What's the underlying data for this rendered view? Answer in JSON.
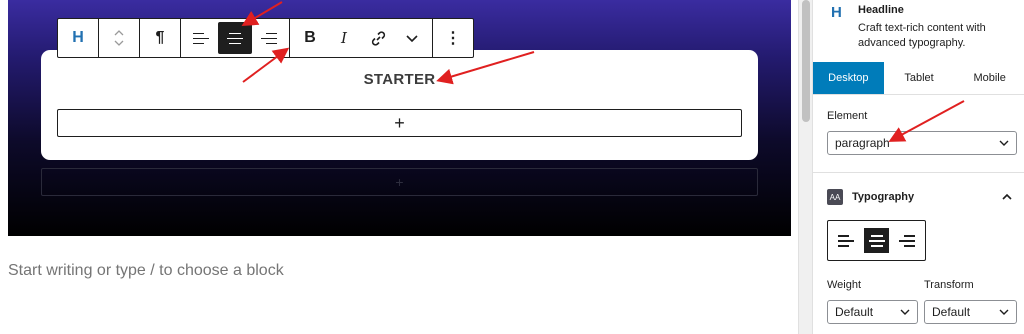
{
  "editor": {
    "card_title": "STARTER",
    "appender_symbol": "+",
    "ghost_appender_symbol": "+",
    "placeholder": "Start writing or type / to choose a block"
  },
  "toolbar": {
    "block_icon": "H",
    "block_icon_name": "headline-block-icon",
    "mover_icon": "up-down-chevron-icon",
    "element_icon": "¶",
    "align_left": "align-left-icon",
    "align_center": "align-center-icon",
    "align_right": "align-right-icon",
    "active_align": "center",
    "bold": "B",
    "italic": "I",
    "link_icon": "link-icon",
    "more_format_icon": "chevron-down-icon",
    "options_icon": "⋮"
  },
  "sidebar": {
    "block": {
      "icon": "H",
      "name": "Headline",
      "description": "Craft text-rich content with advanced typography."
    },
    "device_tabs": [
      {
        "label": "Desktop",
        "active": true
      },
      {
        "label": "Tablet",
        "active": false
      },
      {
        "label": "Mobile",
        "active": false
      }
    ],
    "element": {
      "label": "Element",
      "value": "paragraph"
    },
    "typography": {
      "title": "Typography",
      "icon_text": "AA",
      "active_align": "center"
    },
    "weight": {
      "label": "Weight",
      "value": "Default"
    },
    "transform": {
      "label": "Transform",
      "value": "Default"
    }
  },
  "colors": {
    "accent": "#007cba",
    "brand_icon": "#2271b1",
    "annotation_arrow": "#e02020",
    "hero_top": "#3a2ca0",
    "hero_bottom": "#000000"
  }
}
